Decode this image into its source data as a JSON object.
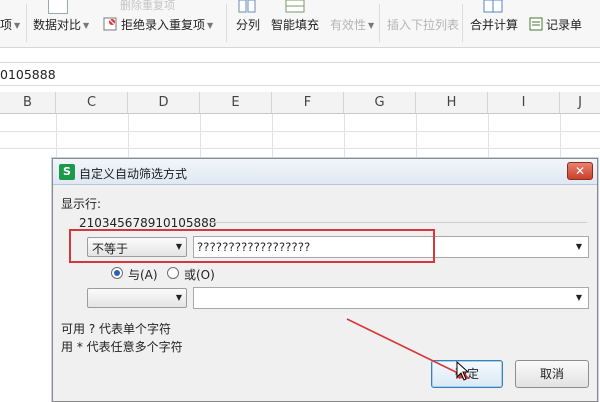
{
  "ribbon": {
    "items": [
      {
        "label": "项",
        "has_caret": true
      },
      {
        "label": "数据对比",
        "has_caret": true
      },
      {
        "label": "拒绝录入重复项",
        "has_caret": true
      },
      {
        "label": "分列"
      },
      {
        "label": "智能填充"
      },
      {
        "label": "有效性",
        "disabled": true,
        "has_caret": true
      },
      {
        "label": "插入下拉列表",
        "disabled": true
      },
      {
        "label": "合并计算"
      },
      {
        "label": "记录单"
      }
    ],
    "faded_top_label": "删除重复项"
  },
  "formula_bar": {
    "value": "0105888"
  },
  "sheet": {
    "columns": [
      "B",
      "C",
      "D",
      "E",
      "F",
      "G",
      "H",
      "I",
      "J"
    ]
  },
  "dialog": {
    "app_icon_letter": "S",
    "title": "自定义自动筛选方式",
    "close_symbol": "✕",
    "show_rows_label": "显示行:",
    "field_name": "210345678910105888",
    "row1": {
      "operator": "不等于",
      "value": "??????????????????"
    },
    "logic": {
      "and_label": "与(A)",
      "or_label": "或(O)",
      "selected": "and"
    },
    "row2": {
      "operator": "",
      "value": ""
    },
    "hint1": "可用 ? 代表单个字符",
    "hint2": "用 * 代表任意多个字符",
    "ok_label": "确定",
    "cancel_label": "取消"
  },
  "colors": {
    "highlight": "#d8373a",
    "annotation_arrow": "#d8373a",
    "app_icon": "#1d9a47"
  }
}
